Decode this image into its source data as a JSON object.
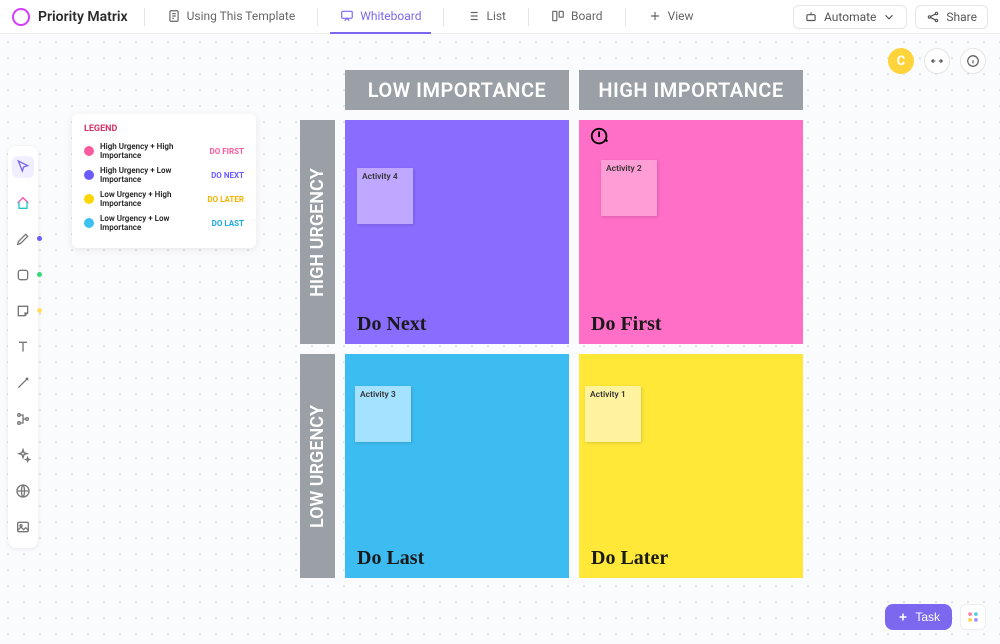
{
  "header": {
    "title": "Priority Matrix",
    "tabs": [
      {
        "label": "Using This Template"
      },
      {
        "label": "Whiteboard"
      },
      {
        "label": "List"
      },
      {
        "label": "Board"
      },
      {
        "label": "View"
      }
    ],
    "automate_label": "Automate",
    "share_label": "Share"
  },
  "avatar_initial": "C",
  "legend": {
    "title": "LEGEND",
    "items": [
      {
        "label": "High Urgency + High Importance",
        "action": "DO FIRST",
        "action_color": "#fa5a9e",
        "swatch": "#fa5a9e"
      },
      {
        "label": "High Urgency + Low Importance",
        "action": "DO NEXT",
        "action_color": "#6a5bff",
        "swatch": "#6a5bff"
      },
      {
        "label": "Low Urgency + High Importance",
        "action": "DO LATER",
        "action_color": "#f5b300",
        "swatch": "#ffd500"
      },
      {
        "label": "Low Urgency + Low Importance",
        "action": "DO LAST",
        "action_color": "#1fa8e0",
        "swatch": "#3cc1f0"
      }
    ]
  },
  "matrix": {
    "cols": [
      "LOW IMPORTANCE",
      "HIGH IMPORTANCE"
    ],
    "rows": [
      "HIGH URGENCY",
      "LOW URGENCY"
    ],
    "quadrants": {
      "top_left": {
        "title": "Do Next",
        "bg": "#8a6cff",
        "note_bg": "#bfa8ff",
        "note_label": "Activity 4"
      },
      "top_right": {
        "title": "Do First",
        "bg": "#ff6ec7",
        "note_bg": "#ff9dd6",
        "note_label": "Activity 2"
      },
      "bot_left": {
        "title": "Do Last",
        "bg": "#3dbcf2",
        "note_bg": "#a5e2ff",
        "note_label": "Activity 3"
      },
      "bot_right": {
        "title": "Do Later",
        "bg": "#ffe838",
        "note_bg": "#fff3a0",
        "note_label": "Activity 1"
      }
    }
  },
  "task_button_label": "Task"
}
